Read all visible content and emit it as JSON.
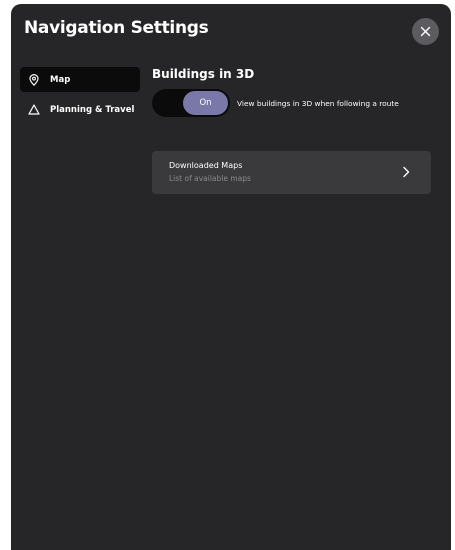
{
  "header": {
    "title": "Navigation Settings",
    "close_icon": "close-icon"
  },
  "sidebar": {
    "items": [
      {
        "label": "Map",
        "icon": "map-pin-icon",
        "active": true
      },
      {
        "label": "Planning & Travel",
        "icon": "navigation-triangle-icon",
        "active": false
      }
    ]
  },
  "main": {
    "buildings": {
      "title": "Buildings in 3D",
      "toggle_state": "On",
      "description": "View buildings in 3D when following a route"
    },
    "downloaded_maps": {
      "title": "Downloaded Maps",
      "subtitle": "List of available maps",
      "icon": "chevron-right-icon"
    }
  },
  "colors": {
    "panel_bg": "#262628",
    "active_item_bg": "#0b0b0c",
    "toggle_on": "#7a78a8",
    "card_bg": "#3a3a3c"
  }
}
